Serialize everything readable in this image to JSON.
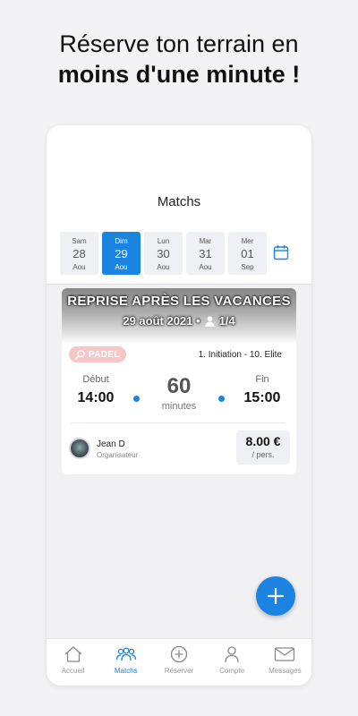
{
  "headline": {
    "line1": "Réserve ton terrain en",
    "line2": "moins d'une minute !"
  },
  "screen": {
    "title": "Matchs",
    "days": [
      {
        "name": "Sam",
        "num": "28",
        "month": "Aou",
        "selected": false
      },
      {
        "name": "Dim",
        "num": "29",
        "month": "Aou",
        "selected": true
      },
      {
        "name": "Lun",
        "num": "30",
        "month": "Aou",
        "selected": false
      },
      {
        "name": "Mar",
        "num": "31",
        "month": "Aou",
        "selected": false
      },
      {
        "name": "Mer",
        "num": "01",
        "month": "Sep",
        "selected": false
      }
    ],
    "calendar_icon": "calendar-icon"
  },
  "match": {
    "title": "REPRISE APRÈS LES VACANCES",
    "date": "29 août 2021 •",
    "players": "1/4",
    "sport": "PADEL",
    "level": "1. Initiation - 10. Elite",
    "start_label": "Début",
    "start_time": "14:00",
    "duration": "60",
    "duration_unit": "minutes",
    "end_label": "Fin",
    "end_time": "15:00",
    "organizer_name": "Jean D",
    "organizer_role": "Organisateur",
    "price": "8.00 €",
    "price_unit": "/ pers."
  },
  "tabs": [
    {
      "label": "Accueil",
      "icon": "home-icon",
      "active": false
    },
    {
      "label": "Matchs",
      "icon": "group-icon",
      "active": true
    },
    {
      "label": "Réserver",
      "icon": "plus-circle-icon",
      "active": false
    },
    {
      "label": "Compte",
      "icon": "user-icon",
      "active": false
    },
    {
      "label": "Messages",
      "icon": "mail-icon",
      "active": false
    }
  ],
  "colors": {
    "accent": "#1b84e0",
    "badge": "#f8c6c6",
    "background": "#f3f3f5"
  }
}
